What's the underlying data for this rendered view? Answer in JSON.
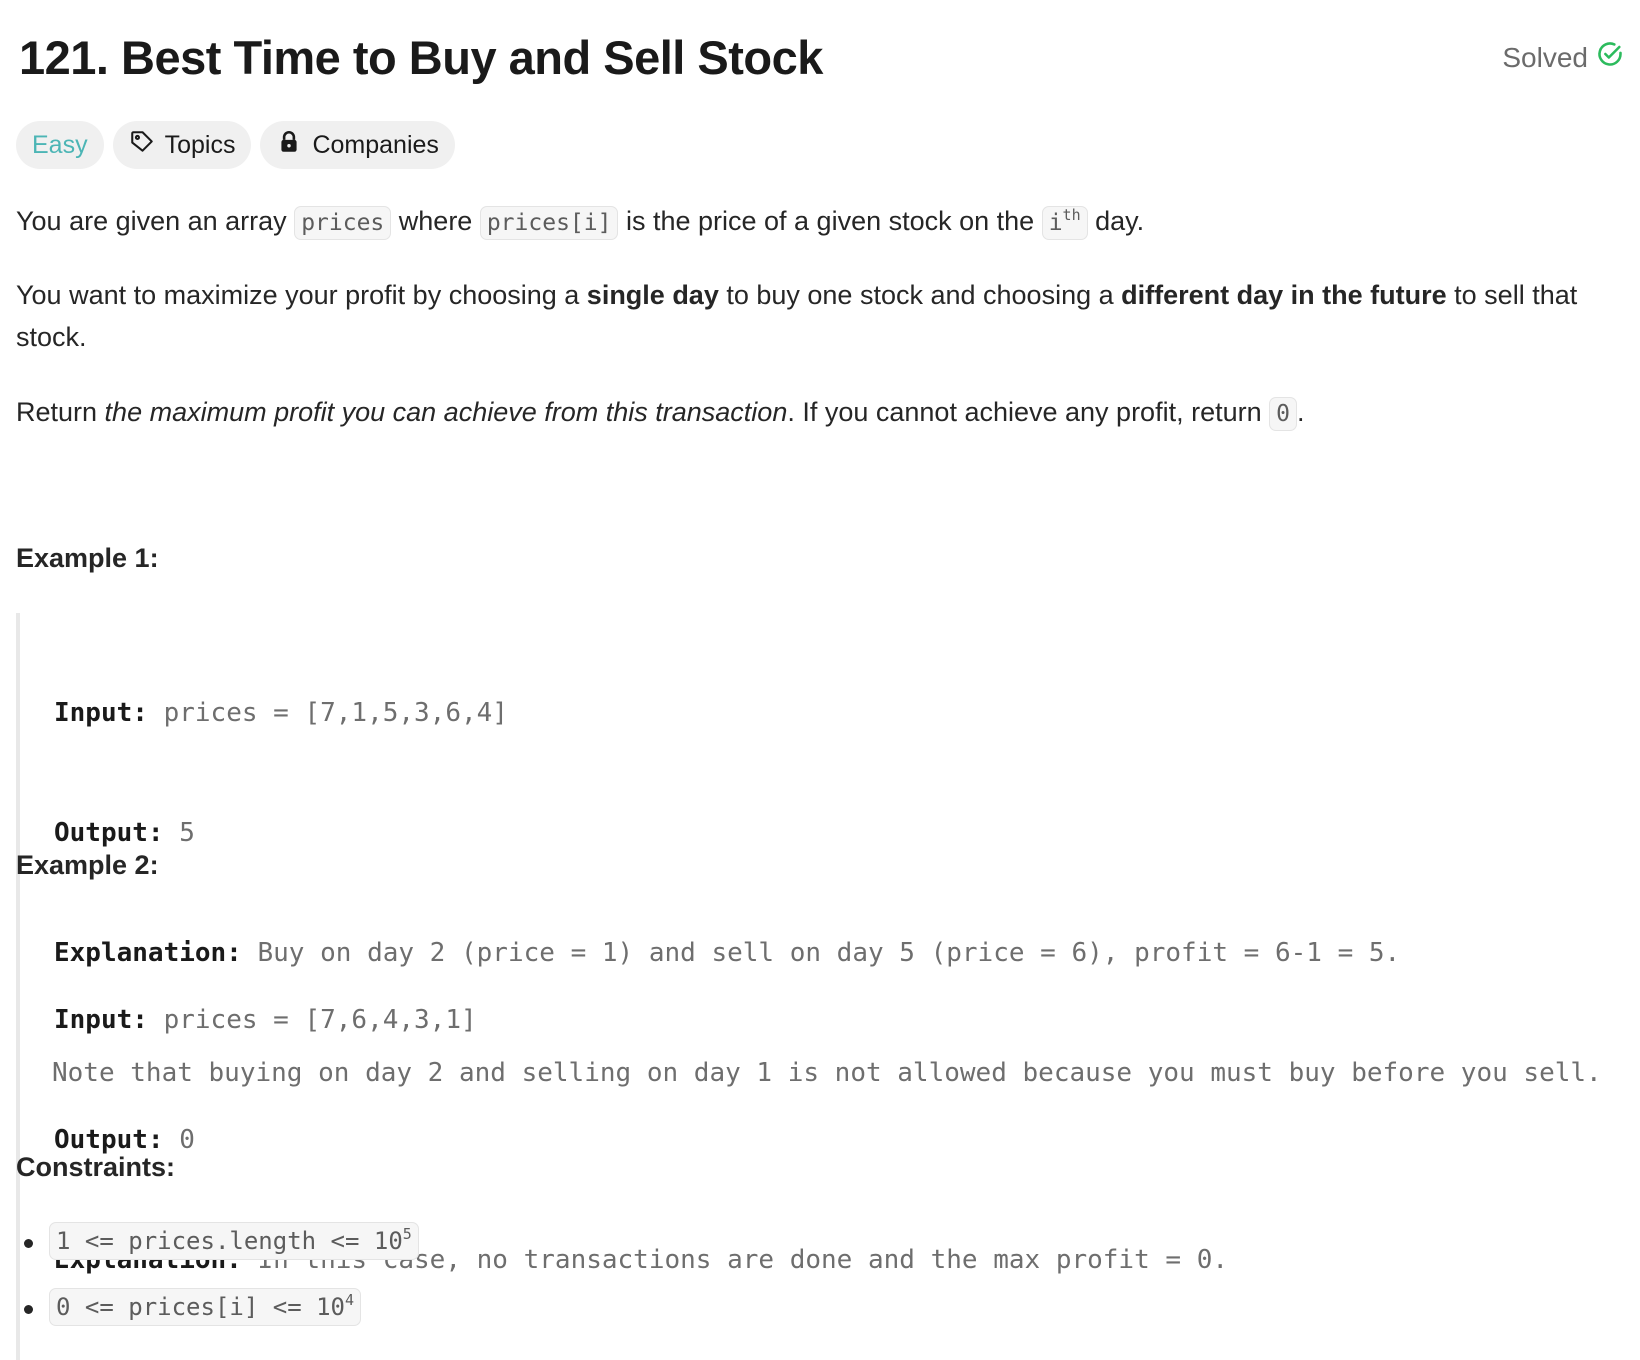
{
  "problem": {
    "title": "121. Best Time to Buy and Sell Stock",
    "status_label": "Solved",
    "status_color": "#2cbb5d",
    "tags": [
      {
        "label": "Easy",
        "color": "#4cb5b5"
      },
      {
        "label": "Topics",
        "icon": "tag-icon"
      },
      {
        "label": "Companies",
        "icon": "lock-icon"
      }
    ]
  },
  "description": {
    "p1": {
      "t1": "You are given an array ",
      "c1": "prices",
      "t2": " where ",
      "c2": "prices[i]",
      "t3": " is the price of a given stock on the ",
      "c3": "i",
      "c3_sup": "th",
      "t4": " day."
    },
    "p2": {
      "t1": "You want to maximize your profit by choosing a ",
      "b1": "single day",
      "t2": " to buy one stock and choosing a ",
      "b2": "different day in the future",
      "t3": " to sell that stock."
    },
    "p3": {
      "t1": "Return ",
      "i1": "the maximum profit you can achieve from this transaction",
      "t2": ". If you cannot achieve any profit, return ",
      "c1": "0",
      "t3": "."
    }
  },
  "examples": [
    {
      "heading": "Example 1:",
      "input_label": "Input:",
      "input_value": "prices = [7,1,5,3,6,4]",
      "output_label": "Output:",
      "output_value": "5",
      "explanation_label": "Explanation:",
      "explanation_value": "Buy on day 2 (price = 1) and sell on day 5 (price = 6), profit = 6-1 = 5.",
      "note": "Note that buying on day 2 and selling on day 1 is not allowed because you must buy before you sell."
    },
    {
      "heading": "Example 2:",
      "input_label": "Input:",
      "input_value": "prices = [7,6,4,3,1]",
      "output_label": "Output:",
      "output_value": "0",
      "explanation_label": "Explanation:",
      "explanation_value": "In this case, no transactions are done and the max profit = 0."
    }
  ],
  "constraints": {
    "heading": "Constraints:",
    "items": [
      {
        "text": "1 <= prices.length <= 10",
        "sup": "5"
      },
      {
        "text": "0 <= prices[i] <= 10",
        "sup": "4"
      }
    ]
  }
}
